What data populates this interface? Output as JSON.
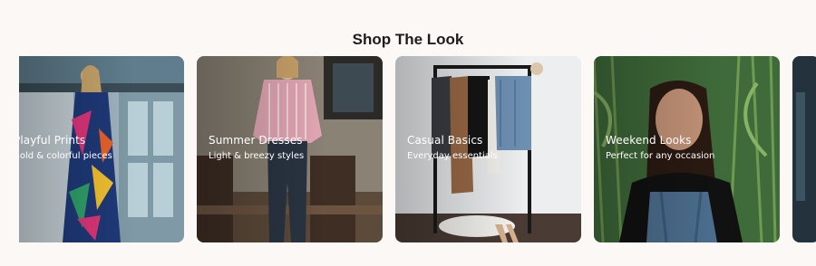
{
  "section": {
    "title": "Shop The Look"
  },
  "cards": [
    {
      "name": "Playful Prints",
      "subtitle": "Bold & colorful pieces"
    },
    {
      "name": "Summer Dresses",
      "subtitle": "Light & breezy styles"
    },
    {
      "name": "Casual Basics",
      "subtitle": "Everyday essentials"
    },
    {
      "name": "Weekend Looks",
      "subtitle": "Perfect for any occasion"
    }
  ]
}
